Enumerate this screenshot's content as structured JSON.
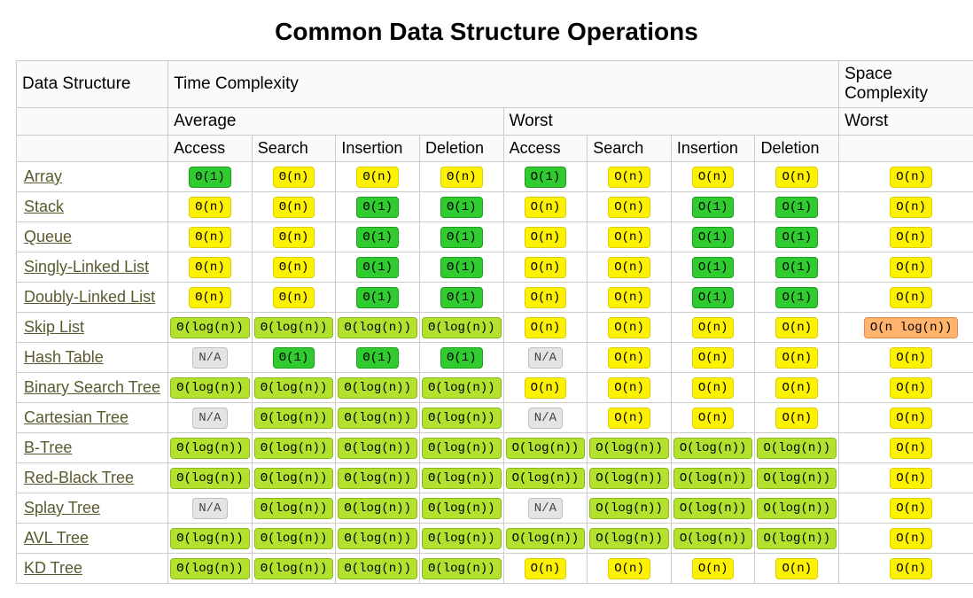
{
  "title": "Common Data Structure Operations",
  "header": {
    "ds": "Data Structure",
    "time": "Time Complexity",
    "space": "Space Complexity",
    "average": "Average",
    "worst": "Worst",
    "space_worst": "Worst",
    "ops": [
      "Access",
      "Search",
      "Insertion",
      "Deletion",
      "Access",
      "Search",
      "Insertion",
      "Deletion"
    ]
  },
  "complexity_colors": {
    "Θ(1)": "c-green",
    "O(1)": "c-green",
    "Θ(log(n))": "c-limegreen",
    "O(log(n))": "c-limegreen",
    "Θ(n)": "c-yellow",
    "O(n)": "c-yellow",
    "Θ(n log(n))": "c-orange",
    "O(n log(n))": "c-orange",
    "N/A": "c-gray"
  },
  "rows": [
    {
      "name": "Array",
      "cells": [
        "Θ(1)",
        "Θ(n)",
        "Θ(n)",
        "Θ(n)",
        "O(1)",
        "O(n)",
        "O(n)",
        "O(n)"
      ],
      "space": "O(n)"
    },
    {
      "name": "Stack",
      "cells": [
        "Θ(n)",
        "Θ(n)",
        "Θ(1)",
        "Θ(1)",
        "O(n)",
        "O(n)",
        "O(1)",
        "O(1)"
      ],
      "space": "O(n)"
    },
    {
      "name": "Queue",
      "cells": [
        "Θ(n)",
        "Θ(n)",
        "Θ(1)",
        "Θ(1)",
        "O(n)",
        "O(n)",
        "O(1)",
        "O(1)"
      ],
      "space": "O(n)"
    },
    {
      "name": "Singly-Linked List",
      "cells": [
        "Θ(n)",
        "Θ(n)",
        "Θ(1)",
        "Θ(1)",
        "O(n)",
        "O(n)",
        "O(1)",
        "O(1)"
      ],
      "space": "O(n)"
    },
    {
      "name": "Doubly-Linked List",
      "cells": [
        "Θ(n)",
        "Θ(n)",
        "Θ(1)",
        "Θ(1)",
        "O(n)",
        "O(n)",
        "O(1)",
        "O(1)"
      ],
      "space": "O(n)"
    },
    {
      "name": "Skip List",
      "cells": [
        "Θ(log(n))",
        "Θ(log(n))",
        "Θ(log(n))",
        "Θ(log(n))",
        "O(n)",
        "O(n)",
        "O(n)",
        "O(n)"
      ],
      "space": "O(n log(n))"
    },
    {
      "name": "Hash Table",
      "cells": [
        "N/A",
        "Θ(1)",
        "Θ(1)",
        "Θ(1)",
        "N/A",
        "O(n)",
        "O(n)",
        "O(n)"
      ],
      "space": "O(n)"
    },
    {
      "name": "Binary Search Tree",
      "cells": [
        "Θ(log(n))",
        "Θ(log(n))",
        "Θ(log(n))",
        "Θ(log(n))",
        "O(n)",
        "O(n)",
        "O(n)",
        "O(n)"
      ],
      "space": "O(n)"
    },
    {
      "name": "Cartesian Tree",
      "cells": [
        "N/A",
        "Θ(log(n))",
        "Θ(log(n))",
        "Θ(log(n))",
        "N/A",
        "O(n)",
        "O(n)",
        "O(n)"
      ],
      "space": "O(n)"
    },
    {
      "name": "B-Tree",
      "cells": [
        "Θ(log(n))",
        "Θ(log(n))",
        "Θ(log(n))",
        "Θ(log(n))",
        "O(log(n))",
        "O(log(n))",
        "O(log(n))",
        "O(log(n))"
      ],
      "space": "O(n)"
    },
    {
      "name": "Red-Black Tree",
      "cells": [
        "Θ(log(n))",
        "Θ(log(n))",
        "Θ(log(n))",
        "Θ(log(n))",
        "O(log(n))",
        "O(log(n))",
        "O(log(n))",
        "O(log(n))"
      ],
      "space": "O(n)"
    },
    {
      "name": "Splay Tree",
      "cells": [
        "N/A",
        "Θ(log(n))",
        "Θ(log(n))",
        "Θ(log(n))",
        "N/A",
        "O(log(n))",
        "O(log(n))",
        "O(log(n))"
      ],
      "space": "O(n)"
    },
    {
      "name": "AVL Tree",
      "cells": [
        "Θ(log(n))",
        "Θ(log(n))",
        "Θ(log(n))",
        "Θ(log(n))",
        "O(log(n))",
        "O(log(n))",
        "O(log(n))",
        "O(log(n))"
      ],
      "space": "O(n)"
    },
    {
      "name": "KD Tree",
      "cells": [
        "Θ(log(n))",
        "Θ(log(n))",
        "Θ(log(n))",
        "Θ(log(n))",
        "O(n)",
        "O(n)",
        "O(n)",
        "O(n)"
      ],
      "space": "O(n)"
    }
  ]
}
